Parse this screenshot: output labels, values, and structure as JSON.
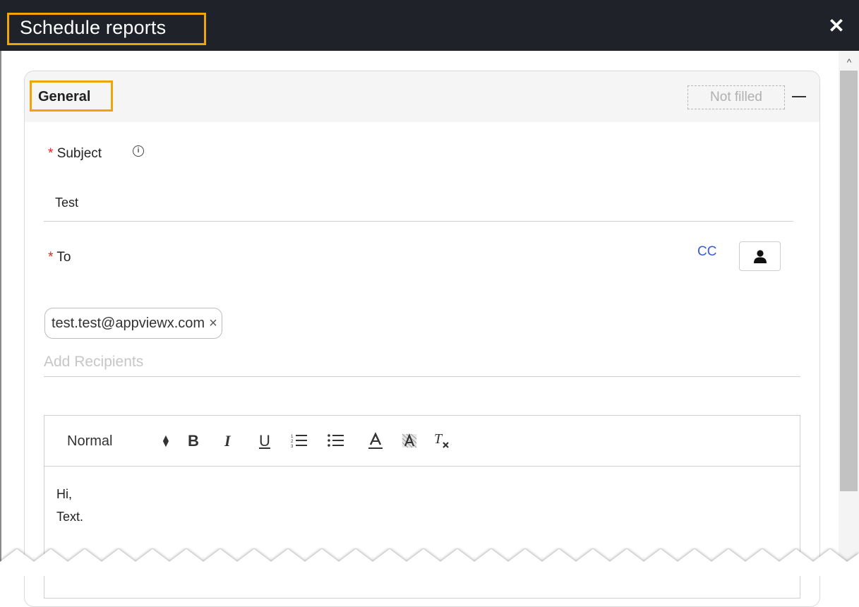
{
  "dialog": {
    "title": "Schedule reports",
    "close_icon": "close-icon"
  },
  "section": {
    "title": "General",
    "status": "Not filled",
    "collapse_icon": "minus-icon"
  },
  "subject": {
    "label": "Subject",
    "required_mark": "*",
    "info_glyph": "i",
    "value": "Test"
  },
  "to": {
    "label": "To",
    "required_mark": "*",
    "cc_label": "CC",
    "user_icon": "user-icon",
    "recipients": [
      {
        "email": "test.test@appviewx.com",
        "remove_glyph": "×"
      }
    ],
    "placeholder": "Add Recipients"
  },
  "editor": {
    "toolbar": {
      "format": "Normal",
      "bold": "B",
      "italic": "I",
      "underline": "U",
      "clear_format": "Tx"
    },
    "body_lines": [
      "Hi,",
      "Text."
    ]
  },
  "colors": {
    "titlebar": "#1f2329",
    "highlight": "#f0a30a",
    "required": "#e0281e",
    "link": "#3b5bd9"
  }
}
